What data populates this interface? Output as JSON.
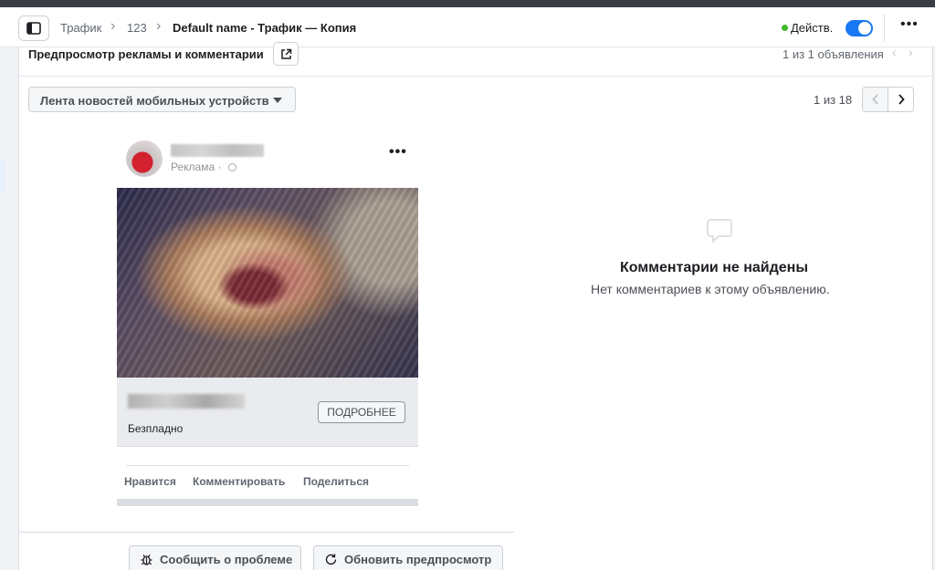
{
  "header": {
    "breadcrumb": [
      "Трафик",
      "123",
      "Default name - Трафик — Копия"
    ],
    "status_label": "Действ.",
    "toggle_on": true
  },
  "preview": {
    "title": "Предпросмотр рекламы и комментарии",
    "ads_count": "1 из 1 объявления",
    "placement": "Лента новостей мобильных устройств",
    "page_count": "1 из 18"
  },
  "ad": {
    "sponsored": "Реклама ·",
    "price": "Безпладно",
    "cta": "ПОДРОБНЕЕ",
    "actions": [
      "Нравится",
      "Комментировать",
      "Поделиться"
    ]
  },
  "comments": {
    "empty_title": "Комментарии не найдены",
    "empty_text": "Нет комментариев к этому объявлению."
  },
  "footer": {
    "report_label": "Сообщить о проблеме",
    "refresh_label": "Обновить предпросмотр"
  },
  "colors": {
    "accent": "#1877f2",
    "status": "#42b72a"
  },
  "icons": {
    "sidebar_toggle": "sidebar-panel-icon",
    "open": "external-link-icon",
    "comment": "speech-bubble-icon",
    "report": "bug-icon",
    "refresh": "refresh-icon"
  }
}
